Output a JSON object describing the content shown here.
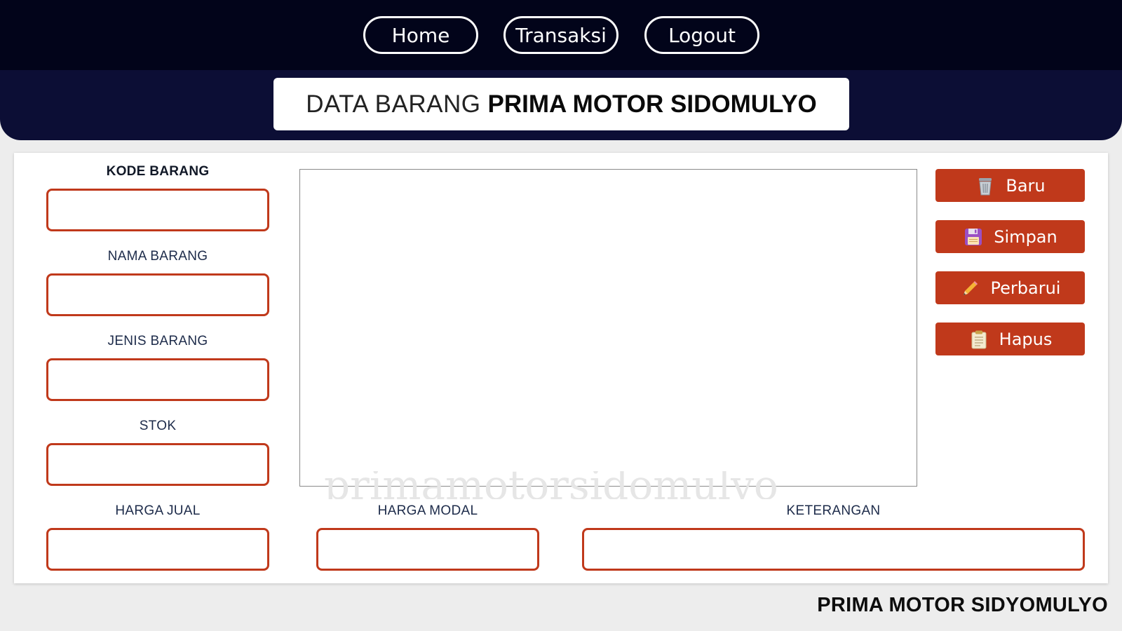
{
  "nav": {
    "home": "Home",
    "transaksi": "Transaksi",
    "logout": "Logout"
  },
  "header": {
    "title_light": "DATA BARANG",
    "title_bold": "PRIMA MOTOR SIDOMULYO"
  },
  "form": {
    "kode_barang": "KODE BARANG",
    "nama_barang": "NAMA BARANG",
    "jenis_barang": "JENIS BARANG",
    "stok": "STOK",
    "harga_jual": "HARGA JUAL",
    "harga_modal": "HARGA MODAL",
    "keterangan": "KETERANGAN"
  },
  "actions": {
    "baru": "Baru",
    "simpan": "Simpan",
    "perbarui": "Perbarui",
    "hapus": "Hapus"
  },
  "watermark": "primamotorsidomulyo",
  "footer": {
    "brand": "PRIMA MOTOR SIDYOMULYO"
  },
  "colors": {
    "nav_bg": "#02041a",
    "header_bg": "#0c0e35",
    "accent": "#c0391b"
  },
  "icons": {
    "baru": "trash-bin-icon",
    "simpan": "floppy-disk-icon",
    "perbarui": "pencil-icon",
    "hapus": "clipboard-icon"
  }
}
